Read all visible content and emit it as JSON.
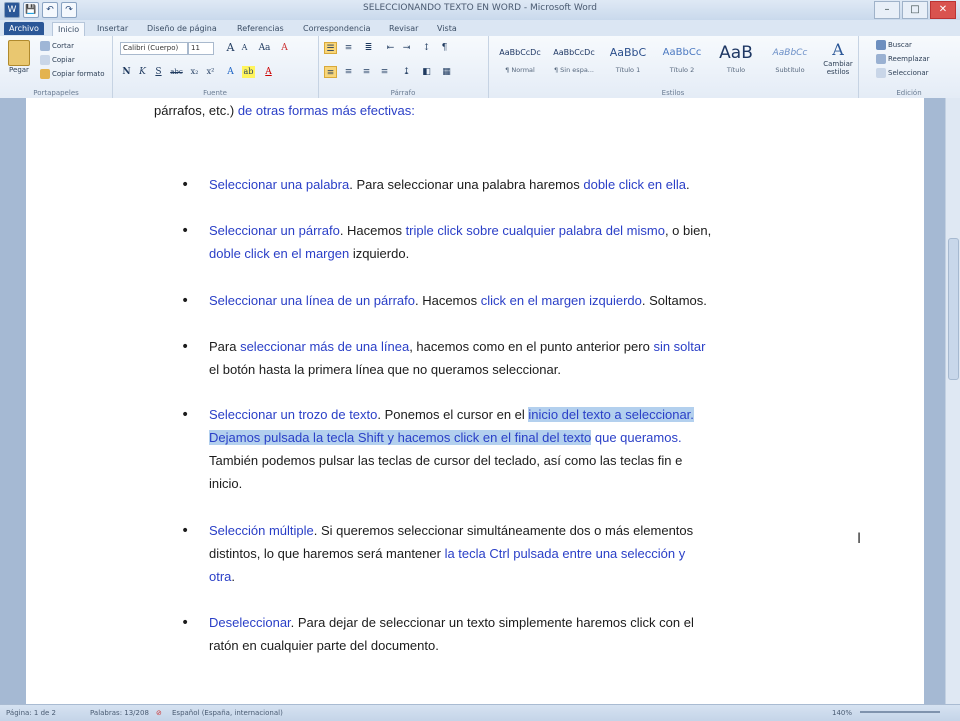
{
  "window": {
    "title": "SELECCIONANDO TEXTO EN WORD - Microsoft Word",
    "controls": {
      "minimize": "–",
      "maximize": "□",
      "close": "✕"
    }
  },
  "quick_access": {
    "save": "💾",
    "undo": "↶",
    "redo": "↷"
  },
  "tabs": [
    "Archivo",
    "Inicio",
    "Insertar",
    "Diseño de página",
    "Referencias",
    "Correspondencia",
    "Revisar",
    "Vista"
  ],
  "ribbon": {
    "clipboard": {
      "label": "Portapapeles",
      "paste": "Pegar",
      "cut": "Cortar",
      "copy": "Copiar",
      "format_painter": "Copiar formato"
    },
    "font": {
      "label": "Fuente",
      "name": "Calibri (Cuerpo)",
      "size": "11",
      "grow": "A",
      "shrink": "A",
      "bold": "N",
      "italic": "K",
      "underline": "S",
      "strike": "abc",
      "sub": "x₂",
      "sup": "x²",
      "clear": "A",
      "highlight": "ab",
      "color": "A"
    },
    "paragraph": {
      "label": "Párrafo"
    },
    "styles": {
      "label": "Estilos",
      "items": [
        {
          "preview": "AaBbCcDc",
          "name": "¶ Normal"
        },
        {
          "preview": "AaBbCcDc",
          "name": "¶ Sin espa..."
        },
        {
          "preview": "AaBbC",
          "name": "Título 1"
        },
        {
          "preview": "AaBbCc",
          "name": "Título 2"
        },
        {
          "preview": "AaB",
          "name": "Título"
        },
        {
          "preview": "AaBbCc",
          "name": "Subtítulo"
        }
      ],
      "change": "Cambiar estilos"
    },
    "editing": {
      "label": "Edición",
      "find": "Buscar",
      "replace": "Reemplazar",
      "select": "Seleccionar"
    }
  },
  "document": {
    "intro": {
      "plain": "párrafos, etc.) ",
      "blue": "de otras formas más efectivas:"
    },
    "bullets": [
      {
        "lines": [
          [
            {
              "t": "Seleccionar una palabra",
              "c": "blue"
            },
            {
              "t": ". Para seleccionar una palabra haremos "
            },
            {
              "t": "doble click en ella",
              "c": "blue"
            },
            {
              "t": "."
            }
          ]
        ]
      },
      {
        "lines": [
          [
            {
              "t": "Seleccionar un párrafo",
              "c": "blue"
            },
            {
              "t": ". Hacemos "
            },
            {
              "t": "triple click sobre cualquier palabra del mismo",
              "c": "blue"
            },
            {
              "t": ", o bien,"
            }
          ],
          [
            {
              "t": "doble click en el margen",
              "c": "blue"
            },
            {
              "t": " izquierdo."
            }
          ]
        ]
      },
      {
        "lines": [
          [
            {
              "t": "Seleccionar una línea de un párrafo",
              "c": "blue"
            },
            {
              "t": ". Hacemos "
            },
            {
              "t": "click en el margen izquierdo",
              "c": "blue"
            },
            {
              "t": ". Soltamos."
            }
          ]
        ]
      },
      {
        "lines": [
          [
            {
              "t": "Para "
            },
            {
              "t": "seleccionar más de una línea",
              "c": "blue"
            },
            {
              "t": ", hacemos como en el punto anterior pero "
            },
            {
              "t": "sin soltar",
              "c": "blue"
            }
          ],
          [
            {
              "t": "el botón hasta la primera línea que no queramos seleccionar."
            }
          ]
        ]
      },
      {
        "lines": [
          [
            {
              "t": "Seleccionar un trozo de texto",
              "c": "blue"
            },
            {
              "t": ". Ponemos el cursor en el "
            },
            {
              "t": "inicio del texto a seleccionar.",
              "c": "blue hl"
            }
          ],
          [
            {
              "t": "Dejamos pulsada la tecla Shift y hacemos click en el final del texto",
              "c": "blue hl"
            },
            {
              "t": " que queramos.",
              "c": "blue"
            }
          ],
          [
            {
              "t": "También podemos pulsar las teclas de cursor del teclado, así como las teclas fin e"
            }
          ],
          [
            {
              "t": "inicio."
            }
          ]
        ]
      },
      {
        "lines": [
          [
            {
              "t": "Selección múltiple",
              "c": "blue"
            },
            {
              "t": ". Si queremos seleccionar simultáneamente dos o más elementos"
            }
          ],
          [
            {
              "t": "distintos, lo que haremos será mantener "
            },
            {
              "t": "la tecla Ctrl pulsada entre una selección y",
              "c": "blue"
            }
          ],
          [
            {
              "t": "otra",
              "c": "blue"
            },
            {
              "t": "."
            }
          ]
        ]
      },
      {
        "lines": [
          [
            {
              "t": "Deseleccionar",
              "c": "blue"
            },
            {
              "t": ". Para dejar de seleccionar un texto simplemente haremos click con el"
            }
          ],
          [
            {
              "t": "ratón en cualquier parte del documento."
            }
          ]
        ]
      }
    ]
  },
  "status": {
    "page": "Página: 1 de 2",
    "words": "Palabras: 13/208",
    "lang": "Español (España, internacional)",
    "zoom": "140%"
  },
  "colors": {
    "file_tab": "#2b5797",
    "doc_text_blue": "#2a3fc7",
    "selection": "#b3d0ee"
  }
}
